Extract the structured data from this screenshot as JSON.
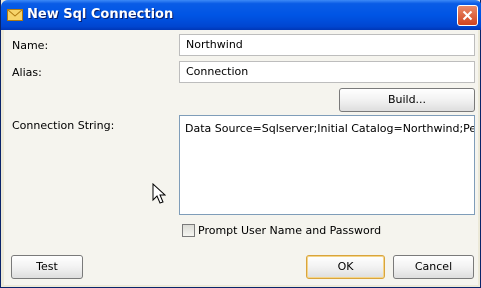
{
  "window": {
    "title": "New Sql Connection"
  },
  "form": {
    "name_label": "Name:",
    "name_value": "Northwind",
    "alias_label": "Alias:",
    "alias_value": "Connection",
    "build_label": "Build...",
    "connection_string_label": "Connection String:",
    "connection_string_value": "Data Source=Sqlserver;Initial Catalog=Northwind;Persist Security Info=True",
    "prompt_label": "Prompt User Name and Password",
    "prompt_checked": false
  },
  "buttons": {
    "test": "Test",
    "ok": "OK",
    "cancel": "Cancel"
  },
  "icons": {
    "app": "envelope-icon",
    "close": "close-icon",
    "cursor": "mouse-pointer-icon"
  },
  "colors": {
    "titlebar": "#0055e5",
    "close": "#d0431f",
    "default_button_border": "#d9a43c"
  }
}
